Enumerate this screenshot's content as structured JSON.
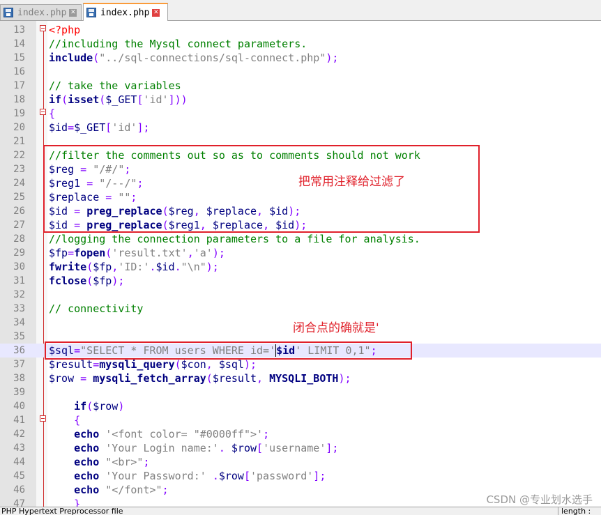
{
  "tabs": [
    {
      "label": "index.php",
      "state": "inactive",
      "icon": "floppy-disk-icon"
    },
    {
      "label": "index.php",
      "state": "active",
      "icon": "floppy-disk-icon"
    }
  ],
  "close_glyph": "✕",
  "lines": [
    {
      "n": "13",
      "tokens": [
        {
          "c": "tg",
          "t": "<?php"
        }
      ]
    },
    {
      "n": "14",
      "tokens": [
        {
          "c": "cm",
          "t": "//including the Mysql connect parameters."
        }
      ]
    },
    {
      "n": "15",
      "tokens": [
        {
          "c": "kw",
          "t": "include"
        },
        {
          "c": "pu",
          "t": "("
        },
        {
          "c": "st",
          "t": "\"../sql-connections/sql-connect.php\""
        },
        {
          "c": "pu",
          "t": ");"
        }
      ]
    },
    {
      "n": "16",
      "tokens": []
    },
    {
      "n": "17",
      "tokens": [
        {
          "c": "cm",
          "t": "// take the variables"
        }
      ]
    },
    {
      "n": "18",
      "tokens": [
        {
          "c": "kw",
          "t": "if"
        },
        {
          "c": "pu",
          "t": "("
        },
        {
          "c": "kw",
          "t": "isset"
        },
        {
          "c": "pu",
          "t": "("
        },
        {
          "c": "vr",
          "t": "$_GET"
        },
        {
          "c": "pu",
          "t": "["
        },
        {
          "c": "st",
          "t": "'id'"
        },
        {
          "c": "pu",
          "t": "]))"
        }
      ]
    },
    {
      "n": "19",
      "tokens": [
        {
          "c": "pu",
          "t": "{"
        }
      ]
    },
    {
      "n": "20",
      "tokens": [
        {
          "c": "vr",
          "t": "$id"
        },
        {
          "c": "pu",
          "t": "="
        },
        {
          "c": "vr",
          "t": "$_GET"
        },
        {
          "c": "pu",
          "t": "["
        },
        {
          "c": "st",
          "t": "'id'"
        },
        {
          "c": "pu",
          "t": "];"
        }
      ]
    },
    {
      "n": "21",
      "tokens": []
    },
    {
      "n": "22",
      "tokens": [
        {
          "c": "cm",
          "t": "//filter the comments out so as to comments should not work"
        }
      ]
    },
    {
      "n": "23",
      "tokens": [
        {
          "c": "vr",
          "t": "$reg"
        },
        {
          "c": "pl",
          "t": " "
        },
        {
          "c": "pu",
          "t": "="
        },
        {
          "c": "pl",
          "t": " "
        },
        {
          "c": "st",
          "t": "\"/#/\""
        },
        {
          "c": "pu",
          "t": ";"
        }
      ]
    },
    {
      "n": "24",
      "tokens": [
        {
          "c": "vr",
          "t": "$reg1"
        },
        {
          "c": "pl",
          "t": " "
        },
        {
          "c": "pu",
          "t": "="
        },
        {
          "c": "pl",
          "t": " "
        },
        {
          "c": "st",
          "t": "\"/--/\""
        },
        {
          "c": "pu",
          "t": ";"
        }
      ]
    },
    {
      "n": "25",
      "tokens": [
        {
          "c": "vr",
          "t": "$replace"
        },
        {
          "c": "pl",
          "t": " "
        },
        {
          "c": "pu",
          "t": "="
        },
        {
          "c": "pl",
          "t": " "
        },
        {
          "c": "st",
          "t": "\"\""
        },
        {
          "c": "pu",
          "t": ";"
        }
      ]
    },
    {
      "n": "26",
      "tokens": [
        {
          "c": "vr",
          "t": "$id"
        },
        {
          "c": "pl",
          "t": " "
        },
        {
          "c": "pu",
          "t": "="
        },
        {
          "c": "pl",
          "t": " "
        },
        {
          "c": "kw",
          "t": "preg_replace"
        },
        {
          "c": "pu",
          "t": "("
        },
        {
          "c": "vr",
          "t": "$reg"
        },
        {
          "c": "pu",
          "t": ","
        },
        {
          "c": "pl",
          "t": " "
        },
        {
          "c": "vr",
          "t": "$replace"
        },
        {
          "c": "pu",
          "t": ","
        },
        {
          "c": "pl",
          "t": " "
        },
        {
          "c": "vr",
          "t": "$id"
        },
        {
          "c": "pu",
          "t": ");"
        }
      ]
    },
    {
      "n": "27",
      "tokens": [
        {
          "c": "vr",
          "t": "$id"
        },
        {
          "c": "pl",
          "t": " "
        },
        {
          "c": "pu",
          "t": "="
        },
        {
          "c": "pl",
          "t": " "
        },
        {
          "c": "kw",
          "t": "preg_replace"
        },
        {
          "c": "pu",
          "t": "("
        },
        {
          "c": "vr",
          "t": "$reg1"
        },
        {
          "c": "pu",
          "t": ","
        },
        {
          "c": "pl",
          "t": " "
        },
        {
          "c": "vr",
          "t": "$replace"
        },
        {
          "c": "pu",
          "t": ","
        },
        {
          "c": "pl",
          "t": " "
        },
        {
          "c": "vr",
          "t": "$id"
        },
        {
          "c": "pu",
          "t": ");"
        }
      ]
    },
    {
      "n": "28",
      "tokens": [
        {
          "c": "cm",
          "t": "//logging the connection parameters to a file for analysis."
        }
      ]
    },
    {
      "n": "29",
      "tokens": [
        {
          "c": "vr",
          "t": "$fp"
        },
        {
          "c": "pu",
          "t": "="
        },
        {
          "c": "kw",
          "t": "fopen"
        },
        {
          "c": "pu",
          "t": "("
        },
        {
          "c": "st",
          "t": "'result.txt'"
        },
        {
          "c": "pu",
          "t": ","
        },
        {
          "c": "st",
          "t": "'a'"
        },
        {
          "c": "pu",
          "t": ");"
        }
      ]
    },
    {
      "n": "30",
      "tokens": [
        {
          "c": "kw",
          "t": "fwrite"
        },
        {
          "c": "pu",
          "t": "("
        },
        {
          "c": "vr",
          "t": "$fp"
        },
        {
          "c": "pu",
          "t": ","
        },
        {
          "c": "st",
          "t": "'ID:'"
        },
        {
          "c": "pu",
          "t": "."
        },
        {
          "c": "vr",
          "t": "$id"
        },
        {
          "c": "pu",
          "t": "."
        },
        {
          "c": "st",
          "t": "\"\\n\""
        },
        {
          "c": "pu",
          "t": ");"
        }
      ]
    },
    {
      "n": "31",
      "tokens": [
        {
          "c": "kw",
          "t": "fclose"
        },
        {
          "c": "pu",
          "t": "("
        },
        {
          "c": "vr",
          "t": "$fp"
        },
        {
          "c": "pu",
          "t": ");"
        }
      ]
    },
    {
      "n": "32",
      "tokens": []
    },
    {
      "n": "33",
      "tokens": [
        {
          "c": "cm",
          "t": "// connectivity"
        }
      ]
    },
    {
      "n": "34",
      "tokens": []
    },
    {
      "n": "35",
      "tokens": []
    },
    {
      "n": "36",
      "highlight": true,
      "tokens": [
        {
          "c": "vr",
          "t": "$sql"
        },
        {
          "c": "pu",
          "t": "="
        },
        {
          "c": "st",
          "t": "\"SELECT * FROM users WHERE id='"
        },
        {
          "c": "bold",
          "t": "$id",
          "cursor": true
        },
        {
          "c": "st",
          "t": "' LIMIT 0,1\""
        },
        {
          "c": "pu",
          "t": ";"
        }
      ]
    },
    {
      "n": "37",
      "tokens": [
        {
          "c": "vr",
          "t": "$result"
        },
        {
          "c": "pu",
          "t": "="
        },
        {
          "c": "kw",
          "t": "mysqli_query"
        },
        {
          "c": "pu",
          "t": "("
        },
        {
          "c": "vr",
          "t": "$con"
        },
        {
          "c": "pu",
          "t": ","
        },
        {
          "c": "pl",
          "t": " "
        },
        {
          "c": "vr",
          "t": "$sql"
        },
        {
          "c": "pu",
          "t": ");"
        }
      ]
    },
    {
      "n": "38",
      "tokens": [
        {
          "c": "vr",
          "t": "$row"
        },
        {
          "c": "pl",
          "t": " "
        },
        {
          "c": "pu",
          "t": "="
        },
        {
          "c": "pl",
          "t": " "
        },
        {
          "c": "kw",
          "t": "mysqli_fetch_array"
        },
        {
          "c": "pu",
          "t": "("
        },
        {
          "c": "vr",
          "t": "$result"
        },
        {
          "c": "pu",
          "t": ","
        },
        {
          "c": "pl",
          "t": " "
        },
        {
          "c": "kw",
          "t": "MYSQLI_BOTH"
        },
        {
          "c": "pu",
          "t": ");"
        }
      ]
    },
    {
      "n": "39",
      "tokens": []
    },
    {
      "n": "40",
      "tokens": [
        {
          "c": "pl",
          "t": "    "
        },
        {
          "c": "kw",
          "t": "if"
        },
        {
          "c": "pu",
          "t": "("
        },
        {
          "c": "vr",
          "t": "$row"
        },
        {
          "c": "pu",
          "t": ")"
        }
      ]
    },
    {
      "n": "41",
      "tokens": [
        {
          "c": "pl",
          "t": "    "
        },
        {
          "c": "pu",
          "t": "{"
        }
      ]
    },
    {
      "n": "42",
      "tokens": [
        {
          "c": "pl",
          "t": "    "
        },
        {
          "c": "kw",
          "t": "echo"
        },
        {
          "c": "pl",
          "t": " "
        },
        {
          "c": "st",
          "t": "'<font color= \"#0000ff\">'"
        },
        {
          "c": "pu",
          "t": ";"
        }
      ]
    },
    {
      "n": "43",
      "tokens": [
        {
          "c": "pl",
          "t": "    "
        },
        {
          "c": "kw",
          "t": "echo"
        },
        {
          "c": "pl",
          "t": " "
        },
        {
          "c": "st",
          "t": "'Your Login name:'"
        },
        {
          "c": "pu",
          "t": "."
        },
        {
          "c": "pl",
          "t": " "
        },
        {
          "c": "vr",
          "t": "$row"
        },
        {
          "c": "pu",
          "t": "["
        },
        {
          "c": "st",
          "t": "'username'"
        },
        {
          "c": "pu",
          "t": "];"
        }
      ]
    },
    {
      "n": "44",
      "tokens": [
        {
          "c": "pl",
          "t": "    "
        },
        {
          "c": "kw",
          "t": "echo"
        },
        {
          "c": "pl",
          "t": " "
        },
        {
          "c": "st",
          "t": "\"<br>\""
        },
        {
          "c": "pu",
          "t": ";"
        }
      ]
    },
    {
      "n": "45",
      "tokens": [
        {
          "c": "pl",
          "t": "    "
        },
        {
          "c": "kw",
          "t": "echo"
        },
        {
          "c": "pl",
          "t": " "
        },
        {
          "c": "st",
          "t": "'Your Password:'"
        },
        {
          "c": "pl",
          "t": " "
        },
        {
          "c": "pu",
          "t": "."
        },
        {
          "c": "vr",
          "t": "$row"
        },
        {
          "c": "pu",
          "t": "["
        },
        {
          "c": "st",
          "t": "'password'"
        },
        {
          "c": "pu",
          "t": "];"
        }
      ]
    },
    {
      "n": "46",
      "tokens": [
        {
          "c": "pl",
          "t": "    "
        },
        {
          "c": "kw",
          "t": "echo"
        },
        {
          "c": "pl",
          "t": " "
        },
        {
          "c": "st",
          "t": "\"</font>\""
        },
        {
          "c": "pu",
          "t": ";"
        }
      ]
    },
    {
      "n": "47",
      "tokens": [
        {
          "c": "pl",
          "t": "    "
        },
        {
          "c": "pu",
          "t": "}"
        }
      ]
    }
  ],
  "annotations": {
    "filter_note": "把常用注释给过滤了",
    "closure_note": "闭合点的确就是'"
  },
  "watermark": "CSDN @专业划水选手",
  "status": {
    "left": "PHP Hypertext Preprocessor file",
    "right": "length : "
  },
  "colors": {
    "annotation_red": "#e0202a",
    "keyword": "#000080",
    "comment": "#008000",
    "string": "#808080",
    "operator": "#8000ff",
    "php_tag": "#ff0000",
    "highlight_line": "#e8e8ff"
  }
}
